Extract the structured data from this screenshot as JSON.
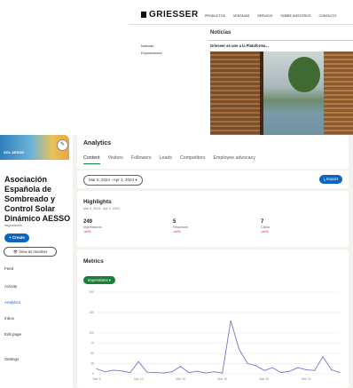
{
  "site": {
    "logo": "GRIESSER",
    "nav": [
      "PRODUCTOS",
      "VENTAJAS",
      "SERVICIO",
      "SOBRE NOSOTROS",
      "CONTACTO"
    ],
    "news_title": "Noticias",
    "left_links": [
      "Noticias",
      "Exposiciones"
    ],
    "headline": "Griesser se une a la Plataforma..."
  },
  "sidebar": {
    "cover_text": "SOL AESSO",
    "edit_icon": "pencil-icon",
    "org_name": [
      "Asociación",
      "Española de",
      "Sombreado y",
      "Control Solar",
      "Dinámico AESSO"
    ],
    "followers": "seguidores",
    "create_label": "+ Create",
    "view_label": "View as member",
    "nav": [
      {
        "label": "Feed",
        "active": false
      },
      {
        "label": "Activity",
        "active": false
      },
      {
        "label": "Analytics",
        "active": true
      },
      {
        "label": "Inbox",
        "active": false
      },
      {
        "label": "Edit page",
        "active": false
      },
      {
        "label": "Settings",
        "active": false
      }
    ]
  },
  "analytics": {
    "title": "Analytics",
    "tabs": [
      "Content",
      "Visitors",
      "Followers",
      "Leads",
      "Competitors",
      "Employee advocacy"
    ],
    "active_tab": 0,
    "date_range": "Mar 5, 2024 - Apr 3, 2024",
    "export_label": "Export",
    "highlights": {
      "title": "Highlights",
      "subtitle": "Mar 5, 2024 - Apr 3, 2024",
      "metrics": [
        {
          "value": "249",
          "label": "Impressions",
          "change": "-xx%"
        },
        {
          "value": "5",
          "label": "Reactions",
          "change": "-xx%"
        },
        {
          "value": "7",
          "label": "Clicks",
          "change": "-xx%"
        }
      ]
    },
    "metrics_card": {
      "title": "Metrics",
      "select_label": "Impressions"
    }
  },
  "chart_data": {
    "type": "line",
    "x": [
      "Mar 5",
      "Mar 6",
      "Mar 7",
      "Mar 8",
      "Mar 9",
      "Mar 10",
      "Mar 11",
      "Mar 12",
      "Mar 13",
      "Mar 14",
      "Mar 15",
      "Mar 16",
      "Mar 17",
      "Mar 18",
      "Mar 19",
      "Mar 20",
      "Mar 21",
      "Mar 22",
      "Mar 23",
      "Mar 24",
      "Mar 25",
      "Mar 26",
      "Mar 27",
      "Mar 28",
      "Mar 29",
      "Mar 30",
      "Mar 31",
      "Apr 1",
      "Apr 2",
      "Apr 3"
    ],
    "series": [
      {
        "values": [
          12,
          5,
          9,
          7,
          3,
          30,
          4,
          3,
          2,
          5,
          18,
          3,
          6,
          2,
          5,
          2,
          130,
          60,
          25,
          20,
          8,
          15,
          3,
          6,
          15,
          10,
          8,
          42,
          10,
          3
        ]
      }
    ],
    "ylim": [
      0,
      200
    ],
    "yticks": [
      0,
      25,
      50,
      75,
      100,
      150,
      200
    ],
    "xticks": [
      "Mar 5",
      "Mar 10",
      "Mar 15",
      "Mar 20",
      "Mar 25",
      "Mar 30"
    ],
    "grid": true,
    "color": "#7b6fd6"
  }
}
